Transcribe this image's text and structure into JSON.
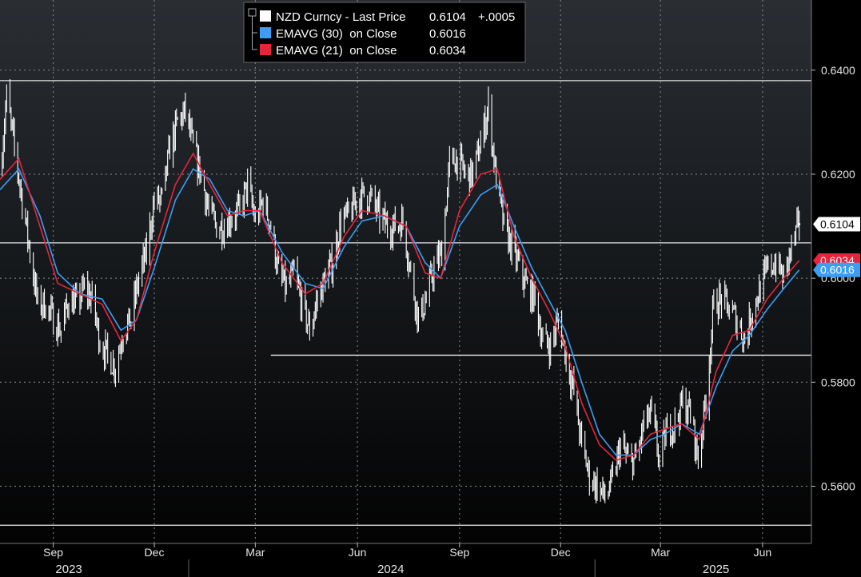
{
  "chart_data": {
    "type": "line",
    "title": "",
    "security": "NZD Curncy",
    "legend_position": "top-center",
    "grid": true,
    "ylim": [
      0.549,
      0.6535
    ],
    "y_ticks": [
      0.56,
      0.58,
      0.6,
      0.62,
      0.64
    ],
    "y_tick_labels": [
      "0.5600",
      "0.5800",
      "0.6000",
      "0.6200",
      "0.6400"
    ],
    "x_ticks": [
      {
        "label": "Sep",
        "date": "2023-09-01"
      },
      {
        "label": "Dec",
        "date": "2023-12-01"
      },
      {
        "label": "Mar",
        "date": "2024-03-01"
      },
      {
        "label": "Jun",
        "date": "2024-06-01"
      },
      {
        "label": "Sep",
        "date": "2024-09-01"
      },
      {
        "label": "Dec",
        "date": "2024-12-01"
      },
      {
        "label": "Mar",
        "date": "2025-03-01"
      },
      {
        "label": "Jun",
        "date": "2025-06-01"
      }
    ],
    "years": [
      {
        "label": "2023",
        "date": "2023-09-15"
      },
      {
        "label": "2024",
        "date": "2024-07-01"
      },
      {
        "label": "2025",
        "date": "2025-04-20"
      }
    ],
    "year_separators": [
      "2024-01-01",
      "2025-01-01"
    ],
    "x_range": [
      "2023-07-15",
      "2025-07-15"
    ],
    "horizontal_lines": [
      {
        "y": 0.638,
        "from": "2023-07-15"
      },
      {
        "y": 0.6068,
        "from": "2023-07-15"
      },
      {
        "y": 0.5852,
        "from": "2024-03-15"
      },
      {
        "y": 0.5525,
        "from": "2023-07-15"
      }
    ],
    "series": [
      {
        "name": "NZD Curncy - Last Price",
        "legend_label": "NZD Curncy - Last Price",
        "legend_value": "0.6104",
        "legend_change": "+.0005",
        "style": "hilo",
        "color": "#ffffff",
        "last_value_label": "0.6104",
        "points": [
          [
            "2023-07-15",
            0.62
          ],
          [
            "2023-07-21",
            0.635
          ],
          [
            "2023-07-28",
            0.625
          ],
          [
            "2023-08-04",
            0.615
          ],
          [
            "2023-08-11",
            0.605
          ],
          [
            "2023-08-18",
            0.595
          ],
          [
            "2023-08-25",
            0.595
          ],
          [
            "2023-09-01",
            0.592
          ],
          [
            "2023-09-08",
            0.59
          ],
          [
            "2023-09-15",
            0.596
          ],
          [
            "2023-09-22",
            0.595
          ],
          [
            "2023-09-29",
            0.598
          ],
          [
            "2023-10-06",
            0.596
          ],
          [
            "2023-10-13",
            0.588
          ],
          [
            "2023-10-20",
            0.585
          ],
          [
            "2023-10-27",
            0.583
          ],
          [
            "2023-11-03",
            0.59
          ],
          [
            "2023-11-10",
            0.592
          ],
          [
            "2023-11-17",
            0.6
          ],
          [
            "2023-11-24",
            0.605
          ],
          [
            "2023-12-01",
            0.615
          ],
          [
            "2023-12-08",
            0.615
          ],
          [
            "2023-12-15",
            0.625
          ],
          [
            "2023-12-22",
            0.63
          ],
          [
            "2023-12-29",
            0.632
          ],
          [
            "2024-01-05",
            0.625
          ],
          [
            "2024-01-12",
            0.62
          ],
          [
            "2024-01-19",
            0.613
          ],
          [
            "2024-01-26",
            0.61
          ],
          [
            "2024-02-02",
            0.61
          ],
          [
            "2024-02-09",
            0.612
          ],
          [
            "2024-02-16",
            0.613
          ],
          [
            "2024-02-23",
            0.618
          ],
          [
            "2024-03-01",
            0.611
          ],
          [
            "2024-03-08",
            0.615
          ],
          [
            "2024-03-15",
            0.61
          ],
          [
            "2024-03-22",
            0.601
          ],
          [
            "2024-03-29",
            0.598
          ],
          [
            "2024-04-05",
            0.601
          ],
          [
            "2024-04-12",
            0.595
          ],
          [
            "2024-04-19",
            0.59
          ],
          [
            "2024-04-26",
            0.596
          ],
          [
            "2024-05-03",
            0.6
          ],
          [
            "2024-05-10",
            0.603
          ],
          [
            "2024-05-17",
            0.611
          ],
          [
            "2024-05-24",
            0.612
          ],
          [
            "2024-05-31",
            0.615
          ],
          [
            "2024-06-07",
            0.616
          ],
          [
            "2024-06-14",
            0.615
          ],
          [
            "2024-06-21",
            0.612
          ],
          [
            "2024-06-28",
            0.61
          ],
          [
            "2024-07-05",
            0.61
          ],
          [
            "2024-07-12",
            0.611
          ],
          [
            "2024-07-19",
            0.601
          ],
          [
            "2024-07-26",
            0.592
          ],
          [
            "2024-08-02",
            0.596
          ],
          [
            "2024-08-09",
            0.602
          ],
          [
            "2024-08-16",
            0.605
          ],
          [
            "2024-08-23",
            0.622
          ],
          [
            "2024-08-30",
            0.623
          ],
          [
            "2024-09-06",
            0.62
          ],
          [
            "2024-09-13",
            0.62
          ],
          [
            "2024-09-20",
            0.626
          ],
          [
            "2024-09-27",
            0.633
          ],
          [
            "2024-10-04",
            0.619
          ],
          [
            "2024-10-11",
            0.61
          ],
          [
            "2024-10-18",
            0.606
          ],
          [
            "2024-10-25",
            0.602
          ],
          [
            "2024-11-01",
            0.598
          ],
          [
            "2024-11-08",
            0.596
          ],
          [
            "2024-11-15",
            0.588
          ],
          [
            "2024-11-22",
            0.587
          ],
          [
            "2024-11-29",
            0.592
          ],
          [
            "2024-12-06",
            0.585
          ],
          [
            "2024-12-13",
            0.578
          ],
          [
            "2024-12-20",
            0.568
          ],
          [
            "2024-12-27",
            0.562
          ],
          [
            "2025-01-03",
            0.56
          ],
          [
            "2025-01-10",
            0.558
          ],
          [
            "2025-01-17",
            0.561
          ],
          [
            "2025-01-24",
            0.568
          ],
          [
            "2025-01-31",
            0.565
          ],
          [
            "2025-02-07",
            0.565
          ],
          [
            "2025-02-14",
            0.572
          ],
          [
            "2025-02-21",
            0.574
          ],
          [
            "2025-02-28",
            0.565
          ],
          [
            "2025-03-07",
            0.571
          ],
          [
            "2025-03-14",
            0.572
          ],
          [
            "2025-03-21",
            0.576
          ],
          [
            "2025-03-28",
            0.574
          ],
          [
            "2025-04-04",
            0.565
          ],
          [
            "2025-04-11",
            0.577
          ],
          [
            "2025-04-18",
            0.595
          ],
          [
            "2025-04-25",
            0.596
          ],
          [
            "2025-05-02",
            0.594
          ],
          [
            "2025-05-09",
            0.592
          ],
          [
            "2025-05-16",
            0.588
          ],
          [
            "2025-05-23",
            0.594
          ],
          [
            "2025-05-30",
            0.598
          ],
          [
            "2025-06-06",
            0.602
          ],
          [
            "2025-06-13",
            0.603
          ],
          [
            "2025-06-20",
            0.6
          ],
          [
            "2025-06-27",
            0.606
          ],
          [
            "2025-07-04",
            0.6104
          ]
        ]
      },
      {
        "name": "EMAVG (30) on Close",
        "legend_label": "EMAVG (30)  on Close",
        "legend_value": "0.6016",
        "style": "line",
        "color": "#3d9df3",
        "last_value_label": "0.6016",
        "points": [
          [
            "2023-07-15",
            0.617
          ],
          [
            "2023-08-01",
            0.621
          ],
          [
            "2023-08-20",
            0.612
          ],
          [
            "2023-09-05",
            0.601
          ],
          [
            "2023-09-25",
            0.597
          ],
          [
            "2023-10-15",
            0.596
          ],
          [
            "2023-11-01",
            0.59
          ],
          [
            "2023-11-15",
            0.592
          ],
          [
            "2023-12-01",
            0.602
          ],
          [
            "2023-12-20",
            0.615
          ],
          [
            "2024-01-05",
            0.621
          ],
          [
            "2024-01-20",
            0.619
          ],
          [
            "2024-02-05",
            0.613
          ],
          [
            "2024-02-20",
            0.612
          ],
          [
            "2024-03-05",
            0.613
          ],
          [
            "2024-03-25",
            0.605
          ],
          [
            "2024-04-15",
            0.599
          ],
          [
            "2024-05-01",
            0.598
          ],
          [
            "2024-05-20",
            0.606
          ],
          [
            "2024-06-05",
            0.611
          ],
          [
            "2024-06-25",
            0.612
          ],
          [
            "2024-07-15",
            0.61
          ],
          [
            "2024-08-01",
            0.603
          ],
          [
            "2024-08-15",
            0.6
          ],
          [
            "2024-09-01",
            0.61
          ],
          [
            "2024-09-20",
            0.616
          ],
          [
            "2024-10-05",
            0.618
          ],
          [
            "2024-10-20",
            0.61
          ],
          [
            "2024-11-05",
            0.602
          ],
          [
            "2024-11-20",
            0.596
          ],
          [
            "2024-12-05",
            0.59
          ],
          [
            "2024-12-20",
            0.58
          ],
          [
            "2025-01-05",
            0.57
          ],
          [
            "2025-01-20",
            0.566
          ],
          [
            "2025-02-05",
            0.566
          ],
          [
            "2025-02-20",
            0.569
          ],
          [
            "2025-03-05",
            0.57
          ],
          [
            "2025-03-20",
            0.572
          ],
          [
            "2025-04-05",
            0.57
          ],
          [
            "2025-04-20",
            0.579
          ],
          [
            "2025-05-05",
            0.586
          ],
          [
            "2025-05-20",
            0.589
          ],
          [
            "2025-06-05",
            0.594
          ],
          [
            "2025-06-20",
            0.598
          ],
          [
            "2025-07-04",
            0.6016
          ]
        ]
      },
      {
        "name": "EMAVG (21) on Close",
        "legend_label": "EMAVG (21)  on Close",
        "legend_value": "0.6034",
        "style": "line",
        "color": "#e8243c",
        "last_value_label": "0.6034",
        "points": [
          [
            "2023-07-15",
            0.619
          ],
          [
            "2023-08-01",
            0.623
          ],
          [
            "2023-08-20",
            0.61
          ],
          [
            "2023-09-05",
            0.599
          ],
          [
            "2023-09-25",
            0.597
          ],
          [
            "2023-10-15",
            0.595
          ],
          [
            "2023-11-01",
            0.588
          ],
          [
            "2023-11-15",
            0.592
          ],
          [
            "2023-12-01",
            0.605
          ],
          [
            "2023-12-20",
            0.618
          ],
          [
            "2024-01-05",
            0.624
          ],
          [
            "2024-01-20",
            0.618
          ],
          [
            "2024-02-05",
            0.612
          ],
          [
            "2024-02-20",
            0.613
          ],
          [
            "2024-03-05",
            0.613
          ],
          [
            "2024-03-25",
            0.603
          ],
          [
            "2024-04-15",
            0.597
          ],
          [
            "2024-05-01",
            0.599
          ],
          [
            "2024-05-20",
            0.608
          ],
          [
            "2024-06-05",
            0.613
          ],
          [
            "2024-06-25",
            0.612
          ],
          [
            "2024-07-15",
            0.61
          ],
          [
            "2024-08-01",
            0.601
          ],
          [
            "2024-08-15",
            0.6
          ],
          [
            "2024-09-01",
            0.613
          ],
          [
            "2024-09-20",
            0.62
          ],
          [
            "2024-10-05",
            0.621
          ],
          [
            "2024-10-20",
            0.608
          ],
          [
            "2024-11-05",
            0.6
          ],
          [
            "2024-11-20",
            0.594
          ],
          [
            "2024-12-05",
            0.587
          ],
          [
            "2024-12-20",
            0.576
          ],
          [
            "2025-01-05",
            0.568
          ],
          [
            "2025-01-20",
            0.565
          ],
          [
            "2025-02-05",
            0.566
          ],
          [
            "2025-02-20",
            0.57
          ],
          [
            "2025-03-05",
            0.571
          ],
          [
            "2025-03-20",
            0.572
          ],
          [
            "2025-04-05",
            0.569
          ],
          [
            "2025-04-20",
            0.582
          ],
          [
            "2025-05-05",
            0.589
          ],
          [
            "2025-05-20",
            0.59
          ],
          [
            "2025-06-05",
            0.596
          ],
          [
            "2025-06-20",
            0.6
          ],
          [
            "2025-07-04",
            0.6034
          ]
        ]
      }
    ]
  }
}
